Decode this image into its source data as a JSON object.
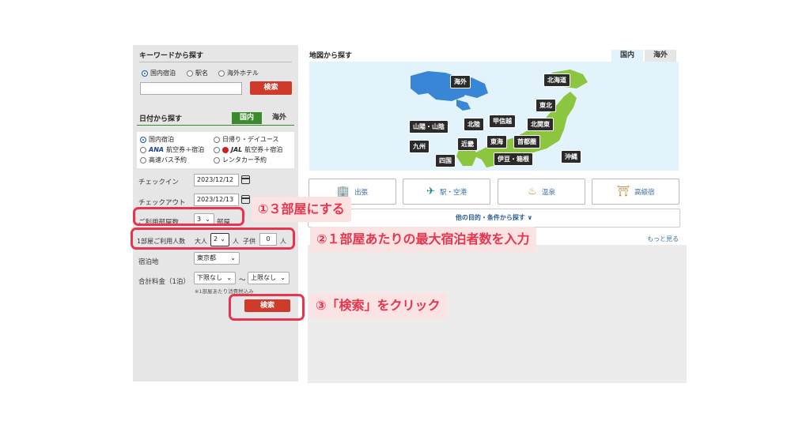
{
  "keyword_search": {
    "title": "キーワードから探す",
    "options": [
      "国内宿泊",
      "駅名",
      "海外ホテル"
    ],
    "search_label": "検索"
  },
  "date_search": {
    "title": "日付から探す",
    "tab_domestic": "国内",
    "tab_overseas": "海外",
    "options": [
      "国内宿泊",
      "日帰り・デイユース",
      "航空券＋宿泊",
      "航空券＋宿泊",
      "高速バス予約",
      "レンタカー予約"
    ],
    "ana_logo": "ANA",
    "jal_logo": "JAL",
    "checkin_label": "チェックイン",
    "checkin_value": "2023/12/12",
    "checkout_label": "チェックアウト",
    "checkout_value": "2023/12/13",
    "rooms_label": "ご利用部屋数",
    "rooms_value": "3",
    "rooms_unit": "部屋",
    "people_label": "1部屋ご利用人数",
    "adult_label": "大人",
    "adult_value": "2",
    "adult_unit": "人",
    "child_label": "子供",
    "child_value": "0",
    "child_unit": "人",
    "location_label": "宿泊地",
    "location_value": "東京都",
    "price_label": "合計料金（1泊）",
    "price_min": "下限なし",
    "price_tilde": "〜",
    "price_max": "上限なし",
    "price_note": "※1部屋あたり消費税込み",
    "search_label": "検索"
  },
  "map_search": {
    "title": "地図から探す",
    "tab_domestic": "国内",
    "tab_overseas": "海外",
    "regions": [
      "海外",
      "北海道",
      "東北",
      "甲信越",
      "北陸",
      "北関東",
      "山陽・山陰",
      "九州",
      "近畿",
      "東海",
      "首都圏",
      "四国",
      "伊豆・箱根",
      "沖縄"
    ]
  },
  "categories": [
    "出張",
    "駅・空港",
    "温泉",
    "高級宿"
  ],
  "more_purpose": "他の目的・条件から探す ∨",
  "more_link": "もっと見る",
  "annotations": {
    "step1": "①３部屋にする",
    "step2": "②１部屋あたりの最大宿泊者数を入力",
    "step3": "③「検索」をクリック"
  },
  "colors": {
    "search_button": "#cf3b2a",
    "tab_active": "#3c8a2e",
    "annotation": "#e8354d",
    "annotation_bg": "#fbe3e3",
    "map_bg": "#e3f3fb",
    "land": "#8cc63f",
    "world_land": "#3a86d6"
  }
}
